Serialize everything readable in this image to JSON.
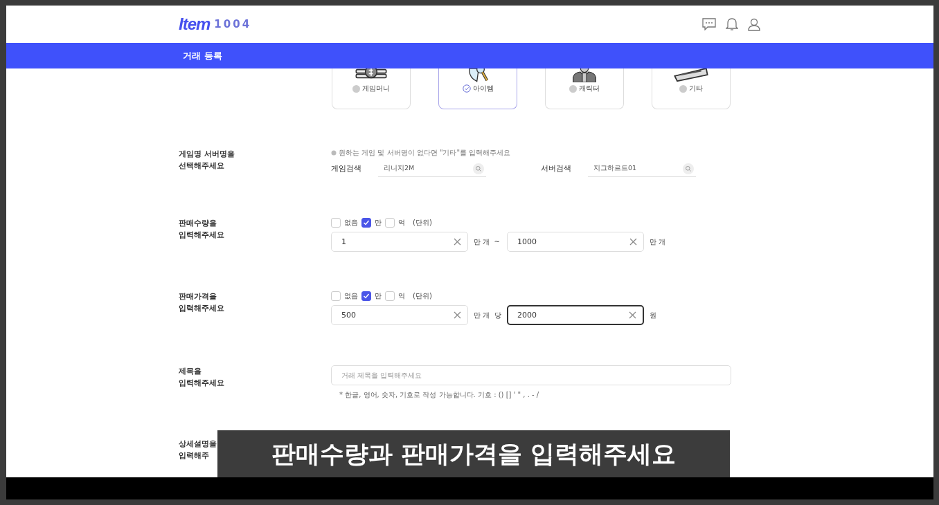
{
  "header": {
    "logo": "Item",
    "logo_number": "1004"
  },
  "page_title": "거래 등록",
  "categories": [
    {
      "kind": "money",
      "label": "게임머니",
      "selected": false
    },
    {
      "kind": "item",
      "label": "아이템",
      "selected": true
    },
    {
      "kind": "character",
      "label": "캐릭터",
      "selected": false
    },
    {
      "kind": "other",
      "label": "기타",
      "selected": false
    }
  ],
  "game_section": {
    "label_lines": [
      "게임명 서버명을",
      "선택해주세요"
    ],
    "hint": "원하는 게임 및 서버명이 없다면 \"기타\"를 입력해주세요",
    "fields": [
      {
        "label": "게임검색",
        "value": "리니지2M"
      },
      {
        "label": "서버검색",
        "value": "지그하르트01"
      }
    ]
  },
  "quantity_section": {
    "label_lines": [
      "판매수량을",
      "입력해주세요"
    ],
    "units": [
      {
        "label": "없음",
        "checked": false
      },
      {
        "label": "만",
        "checked": true
      },
      {
        "label": "억",
        "checked": false
      }
    ],
    "unit_note": "(단위)",
    "inputs": [
      {
        "value": "1",
        "focused": false,
        "suffix": "만 개  ~"
      },
      {
        "value": "1000",
        "focused": false,
        "suffix": "만 개"
      }
    ]
  },
  "price_section": {
    "label_lines": [
      "판매가격을",
      "입력해주세요"
    ],
    "units": [
      {
        "label": "없음",
        "checked": false
      },
      {
        "label": "만",
        "checked": true
      },
      {
        "label": "억",
        "checked": false
      }
    ],
    "unit_note": "(단위)",
    "inputs": [
      {
        "value": "500",
        "focused": false,
        "suffix": "만 개  당"
      },
      {
        "value": "2000",
        "focused": true,
        "suffix": "원"
      }
    ]
  },
  "title_section": {
    "label_lines": [
      "제목을",
      "입력해주세요"
    ],
    "placeholder": "거래 제목을 입력해주세요",
    "hint": "* 한글, 영어, 숫자, 기호로 작성 가능합니다. 기호 : () [] ' \" , . - /"
  },
  "detail_section": {
    "label_lines": [
      "상세설명을",
      "입력해주"
    ]
  },
  "caption": "판매수량과 판매가격을 입력해주세요"
}
